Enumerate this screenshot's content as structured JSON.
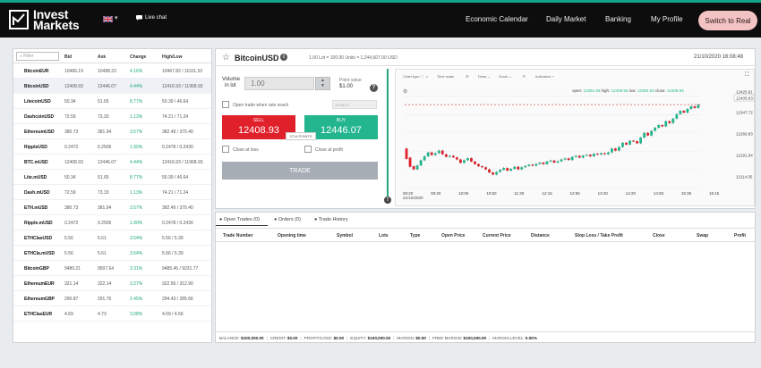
{
  "header": {
    "logo_line1": "Invest",
    "logo_line2": "Markets",
    "live_chat": "Live chat",
    "nav": [
      "Economic Calendar",
      "Daily Market",
      "Banking",
      "My Profile"
    ],
    "switch_button": "Switch to Real"
  },
  "instruments": {
    "filter_placeholder": "Filter",
    "columns": [
      "Bid",
      "Ask",
      "Change",
      "High/Low"
    ],
    "rows": [
      {
        "symbol": "BitcoinEUR",
        "bid": "10466.19",
        "ask": "10498.23",
        "change": "4.16%",
        "highlow": "10467.82 / 10111.52"
      },
      {
        "symbol": "BitcoinUSD",
        "bid": "12408.93",
        "ask": "12446.07",
        "change": "4.44%",
        "highlow": "12416.93 / 11968.93"
      },
      {
        "symbol": "LitecoinUSD",
        "bid": "50.34",
        "ask": "51.65",
        "change": "8.77%",
        "highlow": "50.39 / 46.64"
      },
      {
        "symbol": "DashcoinUSD",
        "bid": "72.59",
        "ask": "73.33",
        "change": "1.13%",
        "highlow": "74.21 / 71.24"
      },
      {
        "symbol": "EthereumUSD",
        "bid": "380.73",
        "ask": "381.94",
        "change": "3.57%",
        "highlow": "382.49 / 370.40"
      },
      {
        "symbol": "RippleUSD",
        "bid": "0.2472",
        "ask": "0.2506",
        "change": "1.90%",
        "highlow": "0.2478 / 0.2430"
      },
      {
        "symbol": "BTC.mUSD",
        "bid": "12408.93",
        "ask": "12446.07",
        "change": "4.44%",
        "highlow": "12416.93 / 11968.93"
      },
      {
        "symbol": "Lite.mUSD",
        "bid": "50.34",
        "ask": "51.65",
        "change": "8.77%",
        "highlow": "50.39 / 46.64"
      },
      {
        "symbol": "Dash.mUSD",
        "bid": "72.59",
        "ask": "73.33",
        "change": "1.13%",
        "highlow": "74.21 / 71.24"
      },
      {
        "symbol": "ETH.mUSD",
        "bid": "380.73",
        "ask": "381.94",
        "change": "3.57%",
        "highlow": "382.49 / 370.40"
      },
      {
        "symbol": "Ripple.mUSD",
        "bid": "0.2472",
        "ask": "0.2506",
        "change": "1.90%",
        "highlow": "0.2478 / 0.2430"
      },
      {
        "symbol": "ETHClasUSD",
        "bid": "5.56",
        "ask": "5.61",
        "change": "3.54%",
        "highlow": "5.56 / 5.39"
      },
      {
        "symbol": "ETHCla.mUSD",
        "bid": "5.56",
        "ask": "5.61",
        "change": "3.54%",
        "highlow": "5.56 / 5.39"
      },
      {
        "symbol": "BitcoinGBP",
        "bid": "9480.21",
        "ask": "9507.64",
        "change": "3.31%",
        "highlow": "9485.45 / 9231.77"
      },
      {
        "symbol": "EthereumEUR",
        "bid": "321.14",
        "ask": "322.14",
        "change": "3.27%",
        "highlow": "322.56 / 312.90"
      },
      {
        "symbol": "EthereumGBP",
        "bid": "290.87",
        "ask": "291.76",
        "change": "2.45%",
        "highlow": "294.43 / 285.66"
      },
      {
        "symbol": "ETHClasEUR",
        "bid": "4.69",
        "ask": "4.73",
        "change": "3.08%",
        "highlow": "4.69 / 4.56"
      }
    ]
  },
  "trade": {
    "symbol": "BitcoinUSD",
    "units": "1.00 Lot = 100.00 Units = 1,244,607.00 USD",
    "datetime": "21/10/2020 16:08:48",
    "volume_label_1": "Volume",
    "volume_label_2": "in lot",
    "volume_value": "1.00",
    "point_value_label": "Point value",
    "point_value": "$1.00",
    "open_when_rate": "Open trade when rate reach",
    "rate_placeholder": "12446.07",
    "sell_label": "SELL",
    "sell_price": "12408.93",
    "buy_label": "BUY",
    "buy_price": "12446.07",
    "spread": "3714 POINTS",
    "close_at_loss": "Close at loss",
    "close_at_profit": "Close at profit",
    "trade_button": "TRADE"
  },
  "chart_toolbar": [
    "Chart type",
    "Time scale",
    "Draw",
    "Zoom",
    "Indicators"
  ],
  "chart_data": {
    "type": "candlestick",
    "ohlc_label": {
      "open": "12391.93",
      "high": "12409.93",
      "low": "12392.93",
      "close": "12408.93"
    },
    "y_ticks": [
      "12425.61",
      "12408.93",
      "12347.72",
      "12269.83",
      "12191.94",
      "12114.05"
    ],
    "current_price": "12408.93",
    "x_ticks": [
      "08:20\n21/10/2020",
      "09:20",
      "10:05",
      "10:50",
      "11:30",
      "12:15",
      "12:55",
      "13:40",
      "14:20",
      "14:55",
      "15:35",
      "16:15"
    ],
    "ylim": [
      12090,
      12440
    ],
    "candles": [
      [
        12240,
        12200
      ],
      [
        12205,
        12170
      ],
      [
        12172,
        12160
      ],
      [
        12160,
        12175
      ],
      [
        12175,
        12195
      ],
      [
        12195,
        12210
      ],
      [
        12210,
        12225
      ],
      [
        12225,
        12215
      ],
      [
        12215,
        12222
      ],
      [
        12222,
        12232
      ],
      [
        12232,
        12218
      ],
      [
        12218,
        12208
      ],
      [
        12208,
        12212
      ],
      [
        12212,
        12206
      ],
      [
        12206,
        12198
      ],
      [
        12198,
        12185
      ],
      [
        12185,
        12195
      ],
      [
        12195,
        12203
      ],
      [
        12203,
        12190
      ],
      [
        12190,
        12180
      ],
      [
        12180,
        12172
      ],
      [
        12172,
        12168
      ],
      [
        12168,
        12160
      ],
      [
        12160,
        12148
      ],
      [
        12148,
        12140
      ],
      [
        12140,
        12150
      ],
      [
        12150,
        12158
      ],
      [
        12158,
        12165
      ],
      [
        12165,
        12155
      ],
      [
        12155,
        12162
      ],
      [
        12162,
        12170
      ],
      [
        12170,
        12160
      ],
      [
        12160,
        12168
      ],
      [
        12168,
        12173
      ],
      [
        12173,
        12178
      ],
      [
        12178,
        12174
      ],
      [
        12174,
        12181
      ],
      [
        12181,
        12186
      ],
      [
        12186,
        12180
      ],
      [
        12180,
        12190
      ],
      [
        12190,
        12194
      ],
      [
        12194,
        12186
      ],
      [
        12186,
        12191
      ],
      [
        12191,
        12198
      ],
      [
        12198,
        12202
      ],
      [
        12202,
        12196
      ],
      [
        12196,
        12208
      ],
      [
        12208,
        12212
      ],
      [
        12212,
        12205
      ],
      [
        12205,
        12213
      ],
      [
        12213,
        12216
      ],
      [
        12216,
        12210
      ],
      [
        12210,
        12220
      ],
      [
        12220,
        12217
      ],
      [
        12217,
        12222
      ],
      [
        12222,
        12218
      ],
      [
        12218,
        12225
      ],
      [
        12225,
        12240
      ],
      [
        12240,
        12232
      ],
      [
        12232,
        12246
      ],
      [
        12246,
        12262
      ],
      [
        12262,
        12255
      ],
      [
        12255,
        12270
      ],
      [
        12270,
        12268
      ],
      [
        12268,
        12260
      ],
      [
        12260,
        12282
      ],
      [
        12282,
        12300
      ],
      [
        12300,
        12290
      ],
      [
        12290,
        12308
      ],
      [
        12308,
        12320
      ],
      [
        12320,
        12330
      ],
      [
        12330,
        12325
      ],
      [
        12325,
        12345
      ],
      [
        12345,
        12338
      ],
      [
        12338,
        12355
      ],
      [
        12355,
        12372
      ],
      [
        12372,
        12385
      ],
      [
        12385,
        12378
      ],
      [
        12378,
        12392
      ],
      [
        12392,
        12402
      ],
      [
        12402,
        12396
      ],
      [
        12396,
        12408
      ]
    ]
  },
  "orders": {
    "tabs": [
      "Open Trades (0)",
      "Orders (0)",
      "Trade History"
    ],
    "columns": [
      "Trade Number",
      "Opening time",
      "Symbol",
      "Lots",
      "Type",
      "Open Price",
      "Current Price",
      "Distance",
      "Stop Loss / Take Profit",
      "Close",
      "Swap",
      "Profit"
    ],
    "balance": [
      {
        "label": "BALANCE:",
        "value": "$100,000.00"
      },
      {
        "label": "CREDIT:",
        "value": "$0.00"
      },
      {
        "label": "PROFIT/LOSS:",
        "value": "$0.00"
      },
      {
        "label": "EQUITY:",
        "value": "$100,000.00"
      },
      {
        "label": "MARGIN:",
        "value": "$0.00"
      },
      {
        "label": "FREE MARGIN:",
        "value": "$100,000.00"
      },
      {
        "label": "MARGIN LEVEL:",
        "value": "0.00%"
      }
    ]
  },
  "colors": {
    "accent": "#12a58a",
    "sell": "#e0202a",
    "buy": "#23b58d",
    "switch": "#f3c2c2"
  }
}
